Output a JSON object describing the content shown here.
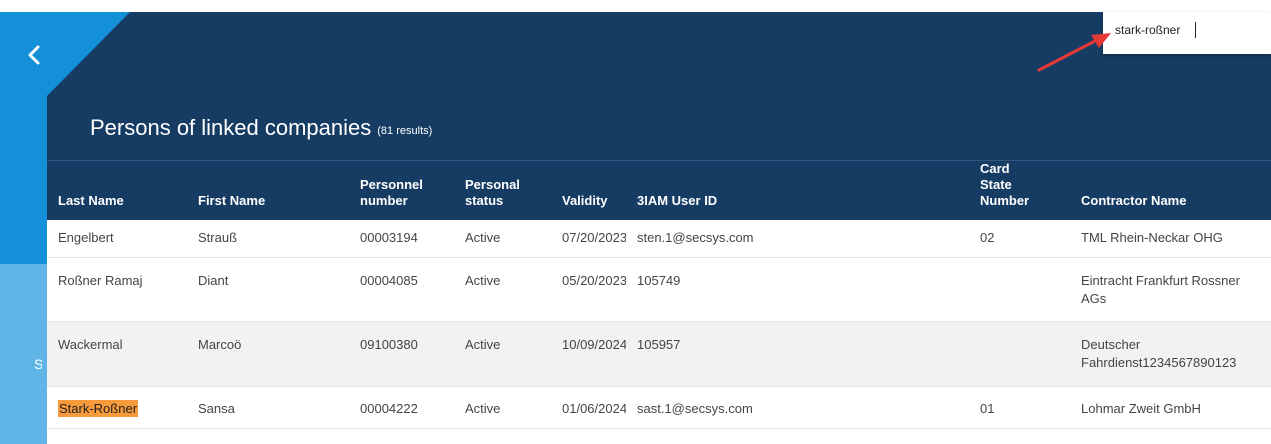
{
  "search": {
    "value": "stark-roßner"
  },
  "panel": {
    "title": "Persons of linked companies",
    "count": "(81 results)"
  },
  "columns": [
    "Last Name",
    "First Name",
    "Personnel number",
    "Personal status",
    "Validity",
    "3IAM User ID",
    "Card State Number",
    "Contractor Name"
  ],
  "rows": [
    {
      "last_name": "Engelbert",
      "first_name": "Strauß",
      "personnel_number": "00003194",
      "status": "Active",
      "validity": "07/20/2023",
      "user_id": "sten.1@secsys.com",
      "card_state": "02",
      "contractor": "TML Rhein-Neckar OHG"
    },
    {
      "last_name": "Roßner Ramaj",
      "first_name": "Diant",
      "personnel_number": "00004085",
      "status": "Active",
      "validity": "05/20/2023",
      "user_id": "105749",
      "card_state": "",
      "contractor": "Eintracht Frankfurt Rossner AGs"
    },
    {
      "last_name": "Wackermal",
      "first_name": "Marcoö",
      "personnel_number": "09100380",
      "status": "Active",
      "validity": "10/09/2024",
      "user_id": "105957",
      "card_state": "",
      "contractor": "Deutscher Fahrdienst1234567890123"
    },
    {
      "last_name": "Stark-Roßner",
      "first_name": "Sansa",
      "personnel_number": "00004222",
      "status": "Active",
      "validity": "01/06/2024",
      "user_id": "sast.1@secsys.com",
      "card_state": "01",
      "contractor": "Lohmar Zweit GmbH"
    }
  ],
  "colors": {
    "header_bg": "#163c64",
    "sidebar_blue": "#1490d8",
    "highlight": "#f79a3b",
    "annotation_arrow": "#e53935"
  },
  "icons": {
    "back": "chevron-left-icon",
    "annotation": "red-arrow-icon"
  }
}
